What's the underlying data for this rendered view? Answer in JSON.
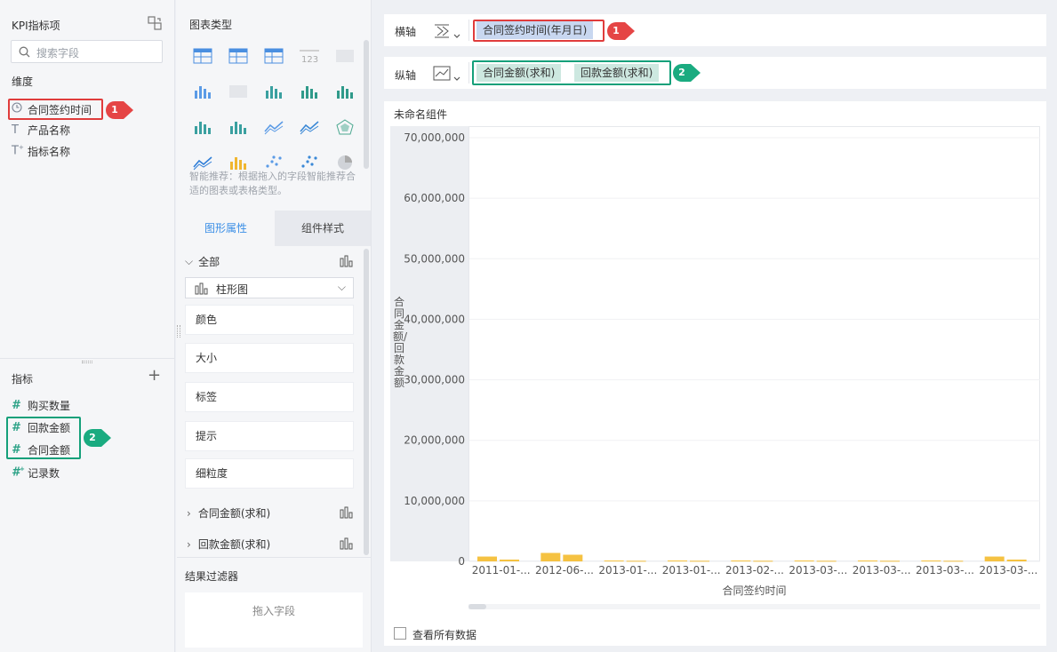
{
  "left_panel": {
    "title": "KPI指标项",
    "search_placeholder": "搜索字段",
    "dimension_header": "维度",
    "dimensions": [
      {
        "icon": "clock-icon",
        "label": "合同签约时间"
      },
      {
        "icon": "text-type-icon",
        "label": "产品名称"
      },
      {
        "icon": "text-type-icon",
        "label": "指标名称"
      }
    ],
    "measure_header": "指标",
    "measures": [
      {
        "icon": "hash-icon",
        "label": "购买数量"
      },
      {
        "icon": "hash-icon",
        "label": "回款金额"
      },
      {
        "icon": "hash-icon",
        "label": "合同金额"
      },
      {
        "icon": "hash-icon",
        "label": "记录数"
      }
    ]
  },
  "markers": {
    "one": "1",
    "two": "2"
  },
  "middle_panel": {
    "chart_type_title": "图表类型",
    "smart_hint": "智能推荐：根据拖入的字段智能推荐合适的图表或表格类型。",
    "tabs": [
      "图形属性",
      "组件样式"
    ],
    "all_label": "全部",
    "chart_select": "柱形图",
    "properties": [
      "颜色",
      "大小",
      "标签",
      "提示",
      "细粒度"
    ],
    "series_groups": [
      "合同金额(求和)",
      "回款金额(求和)"
    ],
    "result_filter_title": "结果过滤器",
    "drop_field": "拖入字段"
  },
  "axes": {
    "x_label": "横轴",
    "x_field": "合同签约时间(年月日)",
    "y_label": "纵轴",
    "y_fields": [
      "合同金额(求和)",
      "回款金额(求和)"
    ]
  },
  "widget": {
    "title": "未命名组件",
    "view_all": "查看所有数据"
  },
  "colors": {
    "accent": "#3a8ee6",
    "bar": "#f5c242",
    "red_box": "#e03c3c",
    "green_box": "#14a07a",
    "teal_pill": "#cde8e0",
    "blue_pill": "#c8d7f0"
  },
  "chart_data": {
    "type": "bar",
    "ylabel": "合同金额/回款金额",
    "xlabel": "合同签约时间",
    "ylim": [
      0,
      70000000
    ],
    "yticks": [
      "70,000,000",
      "60,000,000",
      "50,000,000",
      "40,000,000",
      "30,000,000",
      "20,000,000",
      "10,000,000",
      "0"
    ],
    "categories": [
      "2011-01-...",
      "2012-06-...",
      "2013-01-...",
      "2013-01-...",
      "2013-02-...",
      "2013-03-...",
      "2013-03-...",
      "2013-03-...",
      "2013-03-..."
    ],
    "series": [
      {
        "values": [
          800000,
          1400000,
          150000,
          150000,
          150000,
          150000,
          150000,
          150000,
          800000
        ]
      },
      {
        "values": [
          300000,
          1100000,
          100000,
          100000,
          100000,
          100000,
          100000,
          100000,
          300000
        ]
      }
    ]
  }
}
